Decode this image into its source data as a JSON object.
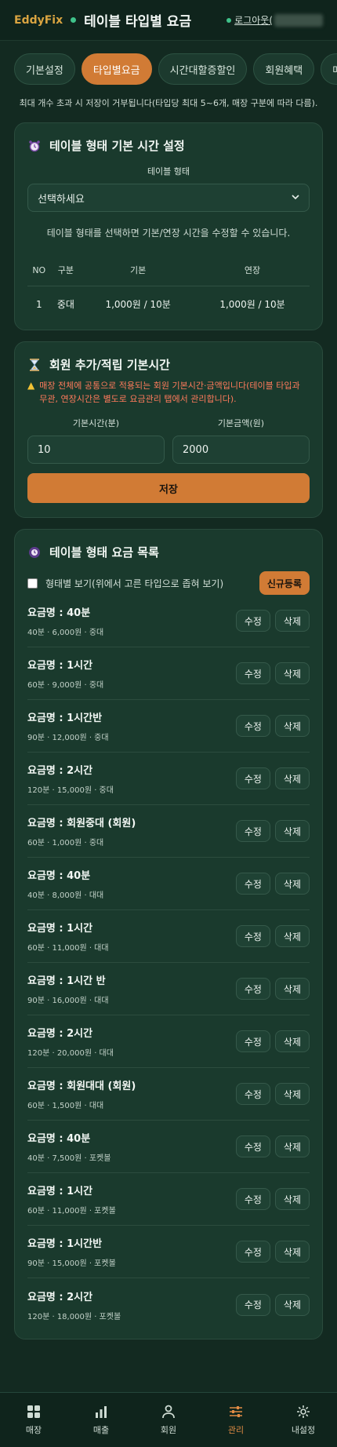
{
  "header": {
    "brand": "EddyFix",
    "title": "테이블 타입별 요금",
    "logout": "로그아웃("
  },
  "tabs": [
    {
      "label": "기본설정"
    },
    {
      "label": "타입별요금",
      "active": true
    },
    {
      "label": "시간대할증할인"
    },
    {
      "label": "회원혜택"
    },
    {
      "label": "매"
    }
  ],
  "notice": "최대 개수 초과 시 저장이 거부됩니다(타입당 최대 5~6개, 매장 구분에 따라 다름).",
  "base_time_card": {
    "title": "테이블 형태 기본 시간 설정",
    "type_label": "테이블 형태",
    "select_value": "선택하세요",
    "hint": "테이블 형태를 선택하면 기본/연장 시간을 수정할 수 있습니다.",
    "table": {
      "headers": [
        "NO",
        "구분",
        "기본",
        "연장"
      ],
      "rows": [
        [
          "1",
          "중대",
          "1,000원 / 10분",
          "1,000원 / 10분"
        ]
      ]
    }
  },
  "member_card": {
    "title": "회원 추가/적립 기본시간",
    "warning": "매장 전체에 공통으로 적용되는 회원 기본시간·금액입니다(테이블 타입과 무관, 연장시간은 별도로 요금관리 탭에서 관리합니다).",
    "base_time_label": "기본시간(분)",
    "base_time_value": "10",
    "base_price_label": "기본금액(원)",
    "base_price_value": "2000",
    "save_label": "저장"
  },
  "rate_list_card": {
    "title": "테이블 형태 요금 목록",
    "filter_label": "형태별 보기(위에서 고른 타입으로 좁혀 보기)",
    "new_label": "신규등록",
    "edit_label": "수정",
    "delete_label": "삭제",
    "items": [
      {
        "name": "요금명 : 40분",
        "sub": "40분 · 6,000원 · 중대"
      },
      {
        "name": "요금명 : 1시간",
        "sub": "60분 · 9,000원 · 중대"
      },
      {
        "name": "요금명 : 1시간반",
        "sub": "90분 · 12,000원 · 중대"
      },
      {
        "name": "요금명 : 2시간",
        "sub": "120분 · 15,000원 · 중대"
      },
      {
        "name": "요금명 : 회원중대 (회원)",
        "sub": "60분 · 1,000원 · 중대"
      },
      {
        "name": "요금명 : 40분",
        "sub": "40분 · 8,000원 · 대대"
      },
      {
        "name": "요금명 : 1시간",
        "sub": "60분 · 11,000원 · 대대"
      },
      {
        "name": "요금명 : 1시간 반",
        "sub": "90분 · 16,000원 · 대대"
      },
      {
        "name": "요금명 : 2시간",
        "sub": "120분 · 20,000원 · 대대"
      },
      {
        "name": "요금명 : 회원대대 (회원)",
        "sub": "60분 · 1,500원 · 대대"
      },
      {
        "name": "요금명 : 40분",
        "sub": "40분 · 7,500원 · 포켓볼"
      },
      {
        "name": "요금명 : 1시간",
        "sub": "60분 · 11,000원 · 포켓볼"
      },
      {
        "name": "요금명 : 1시간반",
        "sub": "90분 · 15,000원 · 포켓볼"
      },
      {
        "name": "요금명 : 2시간",
        "sub": "120분 · 18,000원 · 포켓볼"
      }
    ]
  },
  "bottom_nav": [
    {
      "label": "매장",
      "icon": "grid-icon"
    },
    {
      "label": "매출",
      "icon": "bar-chart-icon"
    },
    {
      "label": "회원",
      "icon": "person-icon"
    },
    {
      "label": "관리",
      "icon": "sliders-icon",
      "active": true
    },
    {
      "label": "내설정",
      "icon": "gear-icon"
    }
  ],
  "colors": {
    "accent": "#d17b35",
    "background": "#132a21",
    "card": "#1a3a2d",
    "warning": "#ff7b5c"
  }
}
